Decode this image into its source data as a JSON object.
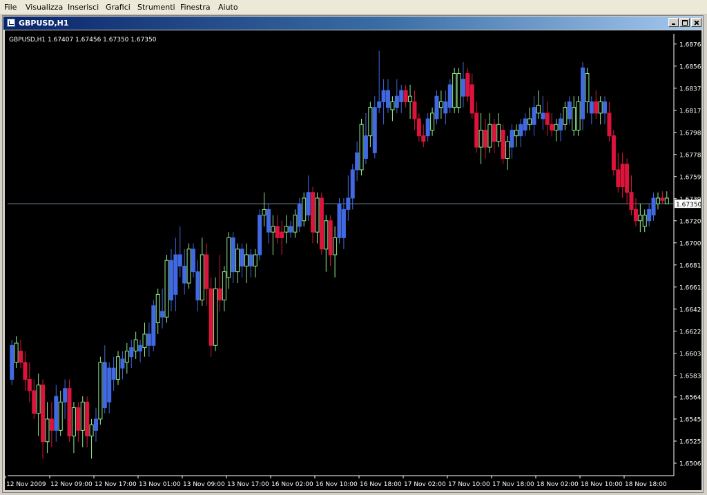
{
  "menu": {
    "items": [
      "File",
      "Visualizza",
      "Inserisci",
      "Grafici",
      "Strumenti",
      "Finestra",
      "Aiuto"
    ]
  },
  "window": {
    "title": "GBPUSD,H1",
    "buttons": [
      "minimize",
      "maximize",
      "close"
    ]
  },
  "chart_data": {
    "type": "candlestick",
    "symbol": "GBPUSD",
    "timeframe": "H1",
    "info_line": "GBPUSD,H1  1.67407 1.67456 1.67350 1.67350",
    "current_price": "1.67350",
    "current_price_value": 1.6735,
    "ylim": [
      1.6495,
      1.6885
    ],
    "y_ticks": [
      "1.68760",
      "1.68565",
      "1.68370",
      "1.68175",
      "1.67980",
      "1.67785",
      "1.67590",
      "1.67395",
      "1.67200",
      "1.67005",
      "1.66810",
      "1.66615",
      "1.66420",
      "1.66225",
      "1.66030",
      "1.65835",
      "1.65645",
      "1.65450",
      "1.65255",
      "1.65060"
    ],
    "x_ticks": [
      "12 Nov 2009",
      "12 Nov 09:00",
      "12 Nov 17:00",
      "13 Nov 01:00",
      "13 Nov 09:00",
      "13 Nov 17:00",
      "16 Nov 02:00",
      "16 Nov 10:00",
      "16 Nov 18:00",
      "17 Nov 02:00",
      "17 Nov 10:00",
      "17 Nov 18:00",
      "18 Nov 02:00",
      "18 Nov 10:00",
      "18 Nov 18:00"
    ],
    "colors": {
      "background": "#000000",
      "axis": "#ffffff",
      "text": "#ffffff",
      "bull_body": "#000000",
      "bull_outline": "#90ee90",
      "bear_body": "#dc143c",
      "blue_body": "#4169e1",
      "wick": "#90ee90",
      "price_line": "#778899"
    },
    "candles": [
      {
        "o": 1.658,
        "h": 1.6615,
        "l": 1.6575,
        "c": 1.661,
        "col": "blue"
      },
      {
        "o": 1.6595,
        "h": 1.6618,
        "l": 1.659,
        "c": 1.6612,
        "col": "green"
      },
      {
        "o": 1.6605,
        "h": 1.6615,
        "l": 1.659,
        "c": 1.6595,
        "col": "red"
      },
      {
        "o": 1.6595,
        "h": 1.6605,
        "l": 1.657,
        "c": 1.658,
        "col": "red"
      },
      {
        "o": 1.658,
        "h": 1.6595,
        "l": 1.656,
        "c": 1.657,
        "col": "red"
      },
      {
        "o": 1.657,
        "h": 1.658,
        "l": 1.6545,
        "c": 1.655,
        "col": "red"
      },
      {
        "o": 1.655,
        "h": 1.6585,
        "l": 1.653,
        "c": 1.6575,
        "col": "green"
      },
      {
        "o": 1.6575,
        "h": 1.658,
        "l": 1.651,
        "c": 1.6525,
        "col": "red"
      },
      {
        "o": 1.6525,
        "h": 1.656,
        "l": 1.6515,
        "c": 1.6545,
        "col": "green"
      },
      {
        "o": 1.6545,
        "h": 1.656,
        "l": 1.652,
        "c": 1.6535,
        "col": "red"
      },
      {
        "o": 1.6535,
        "h": 1.6575,
        "l": 1.6525,
        "c": 1.6565,
        "col": "blue"
      },
      {
        "o": 1.6535,
        "h": 1.657,
        "l": 1.653,
        "c": 1.656,
        "col": "green"
      },
      {
        "o": 1.656,
        "h": 1.658,
        "l": 1.6545,
        "c": 1.6572,
        "col": "blue"
      },
      {
        "o": 1.6572,
        "h": 1.658,
        "l": 1.6525,
        "c": 1.653,
        "col": "red"
      },
      {
        "o": 1.653,
        "h": 1.656,
        "l": 1.6515,
        "c": 1.6555,
        "col": "green"
      },
      {
        "o": 1.6555,
        "h": 1.656,
        "l": 1.6525,
        "c": 1.6535,
        "col": "red"
      },
      {
        "o": 1.6535,
        "h": 1.6565,
        "l": 1.652,
        "c": 1.656,
        "col": "green"
      },
      {
        "o": 1.656,
        "h": 1.6565,
        "l": 1.652,
        "c": 1.653,
        "col": "red"
      },
      {
        "o": 1.653,
        "h": 1.6545,
        "l": 1.651,
        "c": 1.654,
        "col": "green"
      },
      {
        "o": 1.6535,
        "h": 1.6555,
        "l": 1.6525,
        "c": 1.6545,
        "col": "blue"
      },
      {
        "o": 1.6545,
        "h": 1.66,
        "l": 1.654,
        "c": 1.6595,
        "col": "green"
      },
      {
        "o": 1.6595,
        "h": 1.661,
        "l": 1.655,
        "c": 1.6555,
        "col": "blue"
      },
      {
        "o": 1.656,
        "h": 1.6595,
        "l": 1.655,
        "c": 1.659,
        "col": "blue"
      },
      {
        "o": 1.659,
        "h": 1.66,
        "l": 1.657,
        "c": 1.658,
        "col": "blue"
      },
      {
        "o": 1.658,
        "h": 1.6605,
        "l": 1.6575,
        "c": 1.66,
        "col": "green"
      },
      {
        "o": 1.659,
        "h": 1.6605,
        "l": 1.658,
        "c": 1.6598,
        "col": "blue"
      },
      {
        "o": 1.6595,
        "h": 1.6612,
        "l": 1.6585,
        "c": 1.6605,
        "col": "green"
      },
      {
        "o": 1.66,
        "h": 1.6615,
        "l": 1.659,
        "c": 1.6608,
        "col": "blue"
      },
      {
        "o": 1.6605,
        "h": 1.6622,
        "l": 1.6598,
        "c": 1.6615,
        "col": "green"
      },
      {
        "o": 1.6605,
        "h": 1.6615,
        "l": 1.6595,
        "c": 1.661,
        "col": "blue"
      },
      {
        "o": 1.6608,
        "h": 1.663,
        "l": 1.66,
        "c": 1.662,
        "col": "green"
      },
      {
        "o": 1.661,
        "h": 1.663,
        "l": 1.66,
        "c": 1.662,
        "col": "blue"
      },
      {
        "o": 1.661,
        "h": 1.665,
        "l": 1.6605,
        "c": 1.6645,
        "col": "blue"
      },
      {
        "o": 1.663,
        "h": 1.666,
        "l": 1.662,
        "c": 1.6655,
        "col": "green"
      },
      {
        "o": 1.664,
        "h": 1.666,
        "l": 1.6625,
        "c": 1.6635,
        "col": "blue"
      },
      {
        "o": 1.6635,
        "h": 1.669,
        "l": 1.663,
        "c": 1.6685,
        "col": "green"
      },
      {
        "o": 1.6685,
        "h": 1.6695,
        "l": 1.664,
        "c": 1.665,
        "col": "blue"
      },
      {
        "o": 1.6655,
        "h": 1.6705,
        "l": 1.664,
        "c": 1.669,
        "col": "blue"
      },
      {
        "o": 1.669,
        "h": 1.6715,
        "l": 1.667,
        "c": 1.668,
        "col": "blue"
      },
      {
        "o": 1.668,
        "h": 1.6695,
        "l": 1.6655,
        "c": 1.6665,
        "col": "blue"
      },
      {
        "o": 1.6665,
        "h": 1.67,
        "l": 1.666,
        "c": 1.6695,
        "col": "green"
      },
      {
        "o": 1.6695,
        "h": 1.67,
        "l": 1.667,
        "c": 1.6675,
        "col": "blue"
      },
      {
        "o": 1.6675,
        "h": 1.6685,
        "l": 1.664,
        "c": 1.665,
        "col": "blue"
      },
      {
        "o": 1.665,
        "h": 1.6705,
        "l": 1.6645,
        "c": 1.669,
        "col": "green"
      },
      {
        "o": 1.669,
        "h": 1.67,
        "l": 1.6645,
        "c": 1.666,
        "col": "red"
      },
      {
        "o": 1.666,
        "h": 1.667,
        "l": 1.66,
        "c": 1.661,
        "col": "red"
      },
      {
        "o": 1.661,
        "h": 1.667,
        "l": 1.6605,
        "c": 1.666,
        "col": "green"
      },
      {
        "o": 1.666,
        "h": 1.669,
        "l": 1.664,
        "c": 1.665,
        "col": "red"
      },
      {
        "o": 1.665,
        "h": 1.668,
        "l": 1.664,
        "c": 1.6675,
        "col": "green"
      },
      {
        "o": 1.667,
        "h": 1.671,
        "l": 1.666,
        "c": 1.6705,
        "col": "green"
      },
      {
        "o": 1.6705,
        "h": 1.671,
        "l": 1.6665,
        "c": 1.6675,
        "col": "blue"
      },
      {
        "o": 1.6675,
        "h": 1.67,
        "l": 1.6665,
        "c": 1.6695,
        "col": "green"
      },
      {
        "o": 1.6695,
        "h": 1.67,
        "l": 1.667,
        "c": 1.668,
        "col": "blue"
      },
      {
        "o": 1.668,
        "h": 1.67,
        "l": 1.6665,
        "c": 1.669,
        "col": "green"
      },
      {
        "o": 1.669,
        "h": 1.6695,
        "l": 1.667,
        "c": 1.668,
        "col": "blue"
      },
      {
        "o": 1.668,
        "h": 1.6695,
        "l": 1.667,
        "c": 1.669,
        "col": "green"
      },
      {
        "o": 1.669,
        "h": 1.673,
        "l": 1.6685,
        "c": 1.6725,
        "col": "blue"
      },
      {
        "o": 1.6725,
        "h": 1.6745,
        "l": 1.6715,
        "c": 1.673,
        "col": "green"
      },
      {
        "o": 1.673,
        "h": 1.6735,
        "l": 1.67,
        "c": 1.671,
        "col": "blue"
      },
      {
        "o": 1.671,
        "h": 1.6725,
        "l": 1.669,
        "c": 1.6715,
        "col": "green"
      },
      {
        "o": 1.6715,
        "h": 1.6725,
        "l": 1.67,
        "c": 1.6705,
        "col": "red"
      },
      {
        "o": 1.6705,
        "h": 1.672,
        "l": 1.669,
        "c": 1.671,
        "col": "red"
      },
      {
        "o": 1.671,
        "h": 1.6725,
        "l": 1.67,
        "c": 1.6715,
        "col": "green"
      },
      {
        "o": 1.671,
        "h": 1.672,
        "l": 1.6705,
        "c": 1.6715,
        "col": "blue"
      },
      {
        "o": 1.671,
        "h": 1.673,
        "l": 1.6705,
        "c": 1.6725,
        "col": "green"
      },
      {
        "o": 1.6715,
        "h": 1.674,
        "l": 1.671,
        "c": 1.6735,
        "col": "blue"
      },
      {
        "o": 1.672,
        "h": 1.6745,
        "l": 1.6715,
        "c": 1.674,
        "col": "green"
      },
      {
        "o": 1.6725,
        "h": 1.676,
        "l": 1.672,
        "c": 1.6745,
        "col": "blue"
      },
      {
        "o": 1.6745,
        "h": 1.675,
        "l": 1.67,
        "c": 1.671,
        "col": "red"
      },
      {
        "o": 1.671,
        "h": 1.6745,
        "l": 1.67,
        "c": 1.674,
        "col": "green"
      },
      {
        "o": 1.674,
        "h": 1.6745,
        "l": 1.669,
        "c": 1.6695,
        "col": "red"
      },
      {
        "o": 1.6695,
        "h": 1.6725,
        "l": 1.6675,
        "c": 1.672,
        "col": "green"
      },
      {
        "o": 1.672,
        "h": 1.6725,
        "l": 1.668,
        "c": 1.669,
        "col": "red"
      },
      {
        "o": 1.669,
        "h": 1.6715,
        "l": 1.667,
        "c": 1.6705,
        "col": "green"
      },
      {
        "o": 1.6705,
        "h": 1.674,
        "l": 1.67,
        "c": 1.6735,
        "col": "blue"
      },
      {
        "o": 1.6705,
        "h": 1.674,
        "l": 1.6695,
        "c": 1.673,
        "col": "blue"
      },
      {
        "o": 1.673,
        "h": 1.676,
        "l": 1.672,
        "c": 1.674,
        "col": "blue"
      },
      {
        "o": 1.674,
        "h": 1.677,
        "l": 1.673,
        "c": 1.6765,
        "col": "blue"
      },
      {
        "o": 1.6765,
        "h": 1.679,
        "l": 1.6755,
        "c": 1.678,
        "col": "blue"
      },
      {
        "o": 1.6765,
        "h": 1.681,
        "l": 1.676,
        "c": 1.6805,
        "col": "green"
      },
      {
        "o": 1.6775,
        "h": 1.6815,
        "l": 1.677,
        "c": 1.6795,
        "col": "blue"
      },
      {
        "o": 1.6795,
        "h": 1.6825,
        "l": 1.6785,
        "c": 1.682,
        "col": "green"
      },
      {
        "o": 1.678,
        "h": 1.683,
        "l": 1.6775,
        "c": 1.682,
        "col": "blue"
      },
      {
        "o": 1.682,
        "h": 1.687,
        "l": 1.6815,
        "c": 1.6825,
        "col": "blue"
      },
      {
        "o": 1.6825,
        "h": 1.6845,
        "l": 1.6805,
        "c": 1.6835,
        "col": "blue"
      },
      {
        "o": 1.6835,
        "h": 1.6845,
        "l": 1.6815,
        "c": 1.682,
        "col": "blue"
      },
      {
        "o": 1.6818,
        "h": 1.683,
        "l": 1.6808,
        "c": 1.6825,
        "col": "green"
      },
      {
        "o": 1.682,
        "h": 1.6845,
        "l": 1.6815,
        "c": 1.683,
        "col": "blue"
      },
      {
        "o": 1.6825,
        "h": 1.684,
        "l": 1.6815,
        "c": 1.6835,
        "col": "blue"
      },
      {
        "o": 1.6835,
        "h": 1.684,
        "l": 1.682,
        "c": 1.6825,
        "col": "red"
      },
      {
        "o": 1.6825,
        "h": 1.684,
        "l": 1.681,
        "c": 1.683,
        "col": "green"
      },
      {
        "o": 1.6825,
        "h": 1.6835,
        "l": 1.68,
        "c": 1.681,
        "col": "red"
      },
      {
        "o": 1.681,
        "h": 1.6815,
        "l": 1.679,
        "c": 1.6795,
        "col": "red"
      },
      {
        "o": 1.6795,
        "h": 1.6805,
        "l": 1.6785,
        "c": 1.679,
        "col": "red"
      },
      {
        "o": 1.6795,
        "h": 1.6815,
        "l": 1.679,
        "c": 1.681,
        "col": "blue"
      },
      {
        "o": 1.68,
        "h": 1.682,
        "l": 1.6795,
        "c": 1.6815,
        "col": "green"
      },
      {
        "o": 1.681,
        "h": 1.6835,
        "l": 1.6805,
        "c": 1.683,
        "col": "blue"
      },
      {
        "o": 1.682,
        "h": 1.6835,
        "l": 1.681,
        "c": 1.6825,
        "col": "green"
      },
      {
        "o": 1.6815,
        "h": 1.6835,
        "l": 1.6805,
        "c": 1.6825,
        "col": "blue"
      },
      {
        "o": 1.682,
        "h": 1.6845,
        "l": 1.6815,
        "c": 1.684,
        "col": "blue"
      },
      {
        "o": 1.682,
        "h": 1.6855,
        "l": 1.6815,
        "c": 1.685,
        "col": "green"
      },
      {
        "o": 1.682,
        "h": 1.6855,
        "l": 1.6815,
        "c": 1.685,
        "col": "green"
      },
      {
        "o": 1.683,
        "h": 1.686,
        "l": 1.682,
        "c": 1.6845,
        "col": "blue"
      },
      {
        "o": 1.685,
        "h": 1.6855,
        "l": 1.6825,
        "c": 1.683,
        "col": "red"
      },
      {
        "o": 1.684,
        "h": 1.685,
        "l": 1.681,
        "c": 1.6815,
        "col": "red"
      },
      {
        "o": 1.6815,
        "h": 1.6825,
        "l": 1.678,
        "c": 1.6785,
        "col": "red"
      },
      {
        "o": 1.6785,
        "h": 1.6815,
        "l": 1.677,
        "c": 1.68,
        "col": "green"
      },
      {
        "o": 1.68,
        "h": 1.681,
        "l": 1.6775,
        "c": 1.6785,
        "col": "red"
      },
      {
        "o": 1.6785,
        "h": 1.6815,
        "l": 1.678,
        "c": 1.6805,
        "col": "green"
      },
      {
        "o": 1.6805,
        "h": 1.681,
        "l": 1.678,
        "c": 1.679,
        "col": "red"
      },
      {
        "o": 1.679,
        "h": 1.6815,
        "l": 1.6785,
        "c": 1.6805,
        "col": "green"
      },
      {
        "o": 1.68,
        "h": 1.6805,
        "l": 1.677,
        "c": 1.6775,
        "col": "red"
      },
      {
        "o": 1.6775,
        "h": 1.6795,
        "l": 1.6765,
        "c": 1.679,
        "col": "green"
      },
      {
        "o": 1.6785,
        "h": 1.6805,
        "l": 1.6775,
        "c": 1.68,
        "col": "blue"
      },
      {
        "o": 1.6795,
        "h": 1.6805,
        "l": 1.6785,
        "c": 1.68,
        "col": "green"
      },
      {
        "o": 1.6795,
        "h": 1.681,
        "l": 1.6785,
        "c": 1.6805,
        "col": "blue"
      },
      {
        "o": 1.68,
        "h": 1.6815,
        "l": 1.6795,
        "c": 1.681,
        "col": "blue"
      },
      {
        "o": 1.6805,
        "h": 1.682,
        "l": 1.68,
        "c": 1.681,
        "col": "green"
      },
      {
        "o": 1.6805,
        "h": 1.683,
        "l": 1.6795,
        "c": 1.682,
        "col": "blue"
      },
      {
        "o": 1.6815,
        "h": 1.6835,
        "l": 1.681,
        "c": 1.6822,
        "col": "green"
      },
      {
        "o": 1.681,
        "h": 1.683,
        "l": 1.68,
        "c": 1.6815,
        "col": "blue"
      },
      {
        "o": 1.6815,
        "h": 1.6825,
        "l": 1.6795,
        "c": 1.6805,
        "col": "red"
      },
      {
        "o": 1.6805,
        "h": 1.6815,
        "l": 1.6795,
        "c": 1.68,
        "col": "red"
      },
      {
        "o": 1.68,
        "h": 1.681,
        "l": 1.679,
        "c": 1.6805,
        "col": "green"
      },
      {
        "o": 1.68,
        "h": 1.6815,
        "l": 1.679,
        "c": 1.681,
        "col": "blue"
      },
      {
        "o": 1.6805,
        "h": 1.6825,
        "l": 1.68,
        "c": 1.682,
        "col": "green"
      },
      {
        "o": 1.681,
        "h": 1.683,
        "l": 1.6805,
        "c": 1.6825,
        "col": "blue"
      },
      {
        "o": 1.682,
        "h": 1.683,
        "l": 1.6795,
        "c": 1.68,
        "col": "green"
      },
      {
        "o": 1.68,
        "h": 1.683,
        "l": 1.6795,
        "c": 1.6825,
        "col": "green"
      },
      {
        "o": 1.681,
        "h": 1.686,
        "l": 1.68,
        "c": 1.6855,
        "col": "blue"
      },
      {
        "o": 1.6825,
        "h": 1.6855,
        "l": 1.6815,
        "c": 1.685,
        "col": "green"
      },
      {
        "o": 1.6815,
        "h": 1.683,
        "l": 1.6805,
        "c": 1.6825,
        "col": "blue"
      },
      {
        "o": 1.6825,
        "h": 1.6835,
        "l": 1.681,
        "c": 1.6815,
        "col": "red"
      },
      {
        "o": 1.6815,
        "h": 1.683,
        "l": 1.6805,
        "c": 1.6825,
        "col": "green"
      },
      {
        "o": 1.6825,
        "h": 1.683,
        "l": 1.6805,
        "c": 1.6815,
        "col": "blue"
      },
      {
        "o": 1.6815,
        "h": 1.6825,
        "l": 1.679,
        "c": 1.6795,
        "col": "red"
      },
      {
        "o": 1.6795,
        "h": 1.68,
        "l": 1.676,
        "c": 1.6765,
        "col": "red"
      },
      {
        "o": 1.6765,
        "h": 1.678,
        "l": 1.6745,
        "c": 1.675,
        "col": "red"
      },
      {
        "o": 1.675,
        "h": 1.678,
        "l": 1.674,
        "c": 1.677,
        "col": "red"
      },
      {
        "o": 1.677,
        "h": 1.6775,
        "l": 1.6735,
        "c": 1.6745,
        "col": "red"
      },
      {
        "o": 1.6745,
        "h": 1.676,
        "l": 1.6725,
        "c": 1.673,
        "col": "red"
      },
      {
        "o": 1.673,
        "h": 1.674,
        "l": 1.6715,
        "c": 1.672,
        "col": "red"
      },
      {
        "o": 1.672,
        "h": 1.6735,
        "l": 1.671,
        "c": 1.6725,
        "col": "green"
      },
      {
        "o": 1.6715,
        "h": 1.673,
        "l": 1.671,
        "c": 1.6725,
        "col": "green"
      },
      {
        "o": 1.672,
        "h": 1.6735,
        "l": 1.6715,
        "c": 1.673,
        "col": "blue"
      },
      {
        "o": 1.6725,
        "h": 1.6745,
        "l": 1.672,
        "c": 1.674,
        "col": "blue"
      },
      {
        "o": 1.6735,
        "h": 1.6745,
        "l": 1.673,
        "c": 1.674,
        "col": "green"
      },
      {
        "o": 1.674,
        "h": 1.6746,
        "l": 1.6735,
        "c": 1.6738,
        "col": "red"
      },
      {
        "o": 1.674,
        "h": 1.6746,
        "l": 1.6735,
        "c": 1.6735,
        "col": "green"
      }
    ]
  }
}
